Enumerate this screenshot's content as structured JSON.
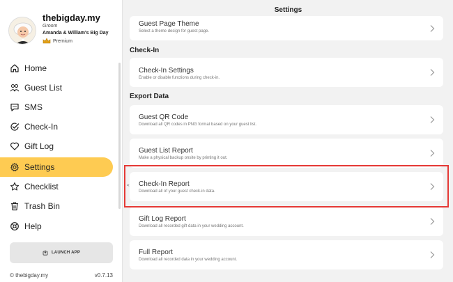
{
  "profile": {
    "brand": "thebigday.my",
    "role": "Groom",
    "event": "Amanda & William's Big Day",
    "plan": "Premium"
  },
  "nav": {
    "items": [
      {
        "label": "Home",
        "icon": "home-icon"
      },
      {
        "label": "Guest List",
        "icon": "guests-icon"
      },
      {
        "label": "SMS",
        "icon": "sms-icon"
      },
      {
        "label": "Check-In",
        "icon": "check-in-icon"
      },
      {
        "label": "Gift Log",
        "icon": "heart-icon"
      },
      {
        "label": "Settings",
        "icon": "gear-icon"
      },
      {
        "label": "Checklist",
        "icon": "star-icon"
      },
      {
        "label": "Trash Bin",
        "icon": "trash-icon"
      },
      {
        "label": "Help",
        "icon": "help-icon"
      }
    ],
    "active": "Settings",
    "active_color": "#fecb52"
  },
  "launch_label": "LAUNCH APP",
  "footer": {
    "copyright": "© thebigday.my",
    "version": "v0.7.13"
  },
  "header": {
    "title": "Settings"
  },
  "sections": {
    "check_in": "Check-In",
    "export": "Export Data"
  },
  "cards": {
    "guest_page_theme": {
      "title": "Guest Page Theme",
      "desc": "Select a theme design for guest page."
    },
    "check_in_settings": {
      "title": "Check-In Settings",
      "desc": "Enable or disable functions during check-in."
    },
    "guest_qr": {
      "title": "Guest QR Code",
      "desc": "Download all QR codes in PNG format based on your guest list."
    },
    "guest_list_report": {
      "title": "Guest List Report",
      "desc": "Make a physical backup onsite by printing it out."
    },
    "check_in_report": {
      "title": "Check-In Report",
      "desc": "Download all of your guest check-in data."
    },
    "gift_log_report": {
      "title": "Gift Log Report",
      "desc": "Download all recorded gift data in your wedding account."
    },
    "full_report": {
      "title": "Full Report",
      "desc": "Download all recorded data in your wedding account."
    }
  },
  "highlight_color": "#e53935"
}
